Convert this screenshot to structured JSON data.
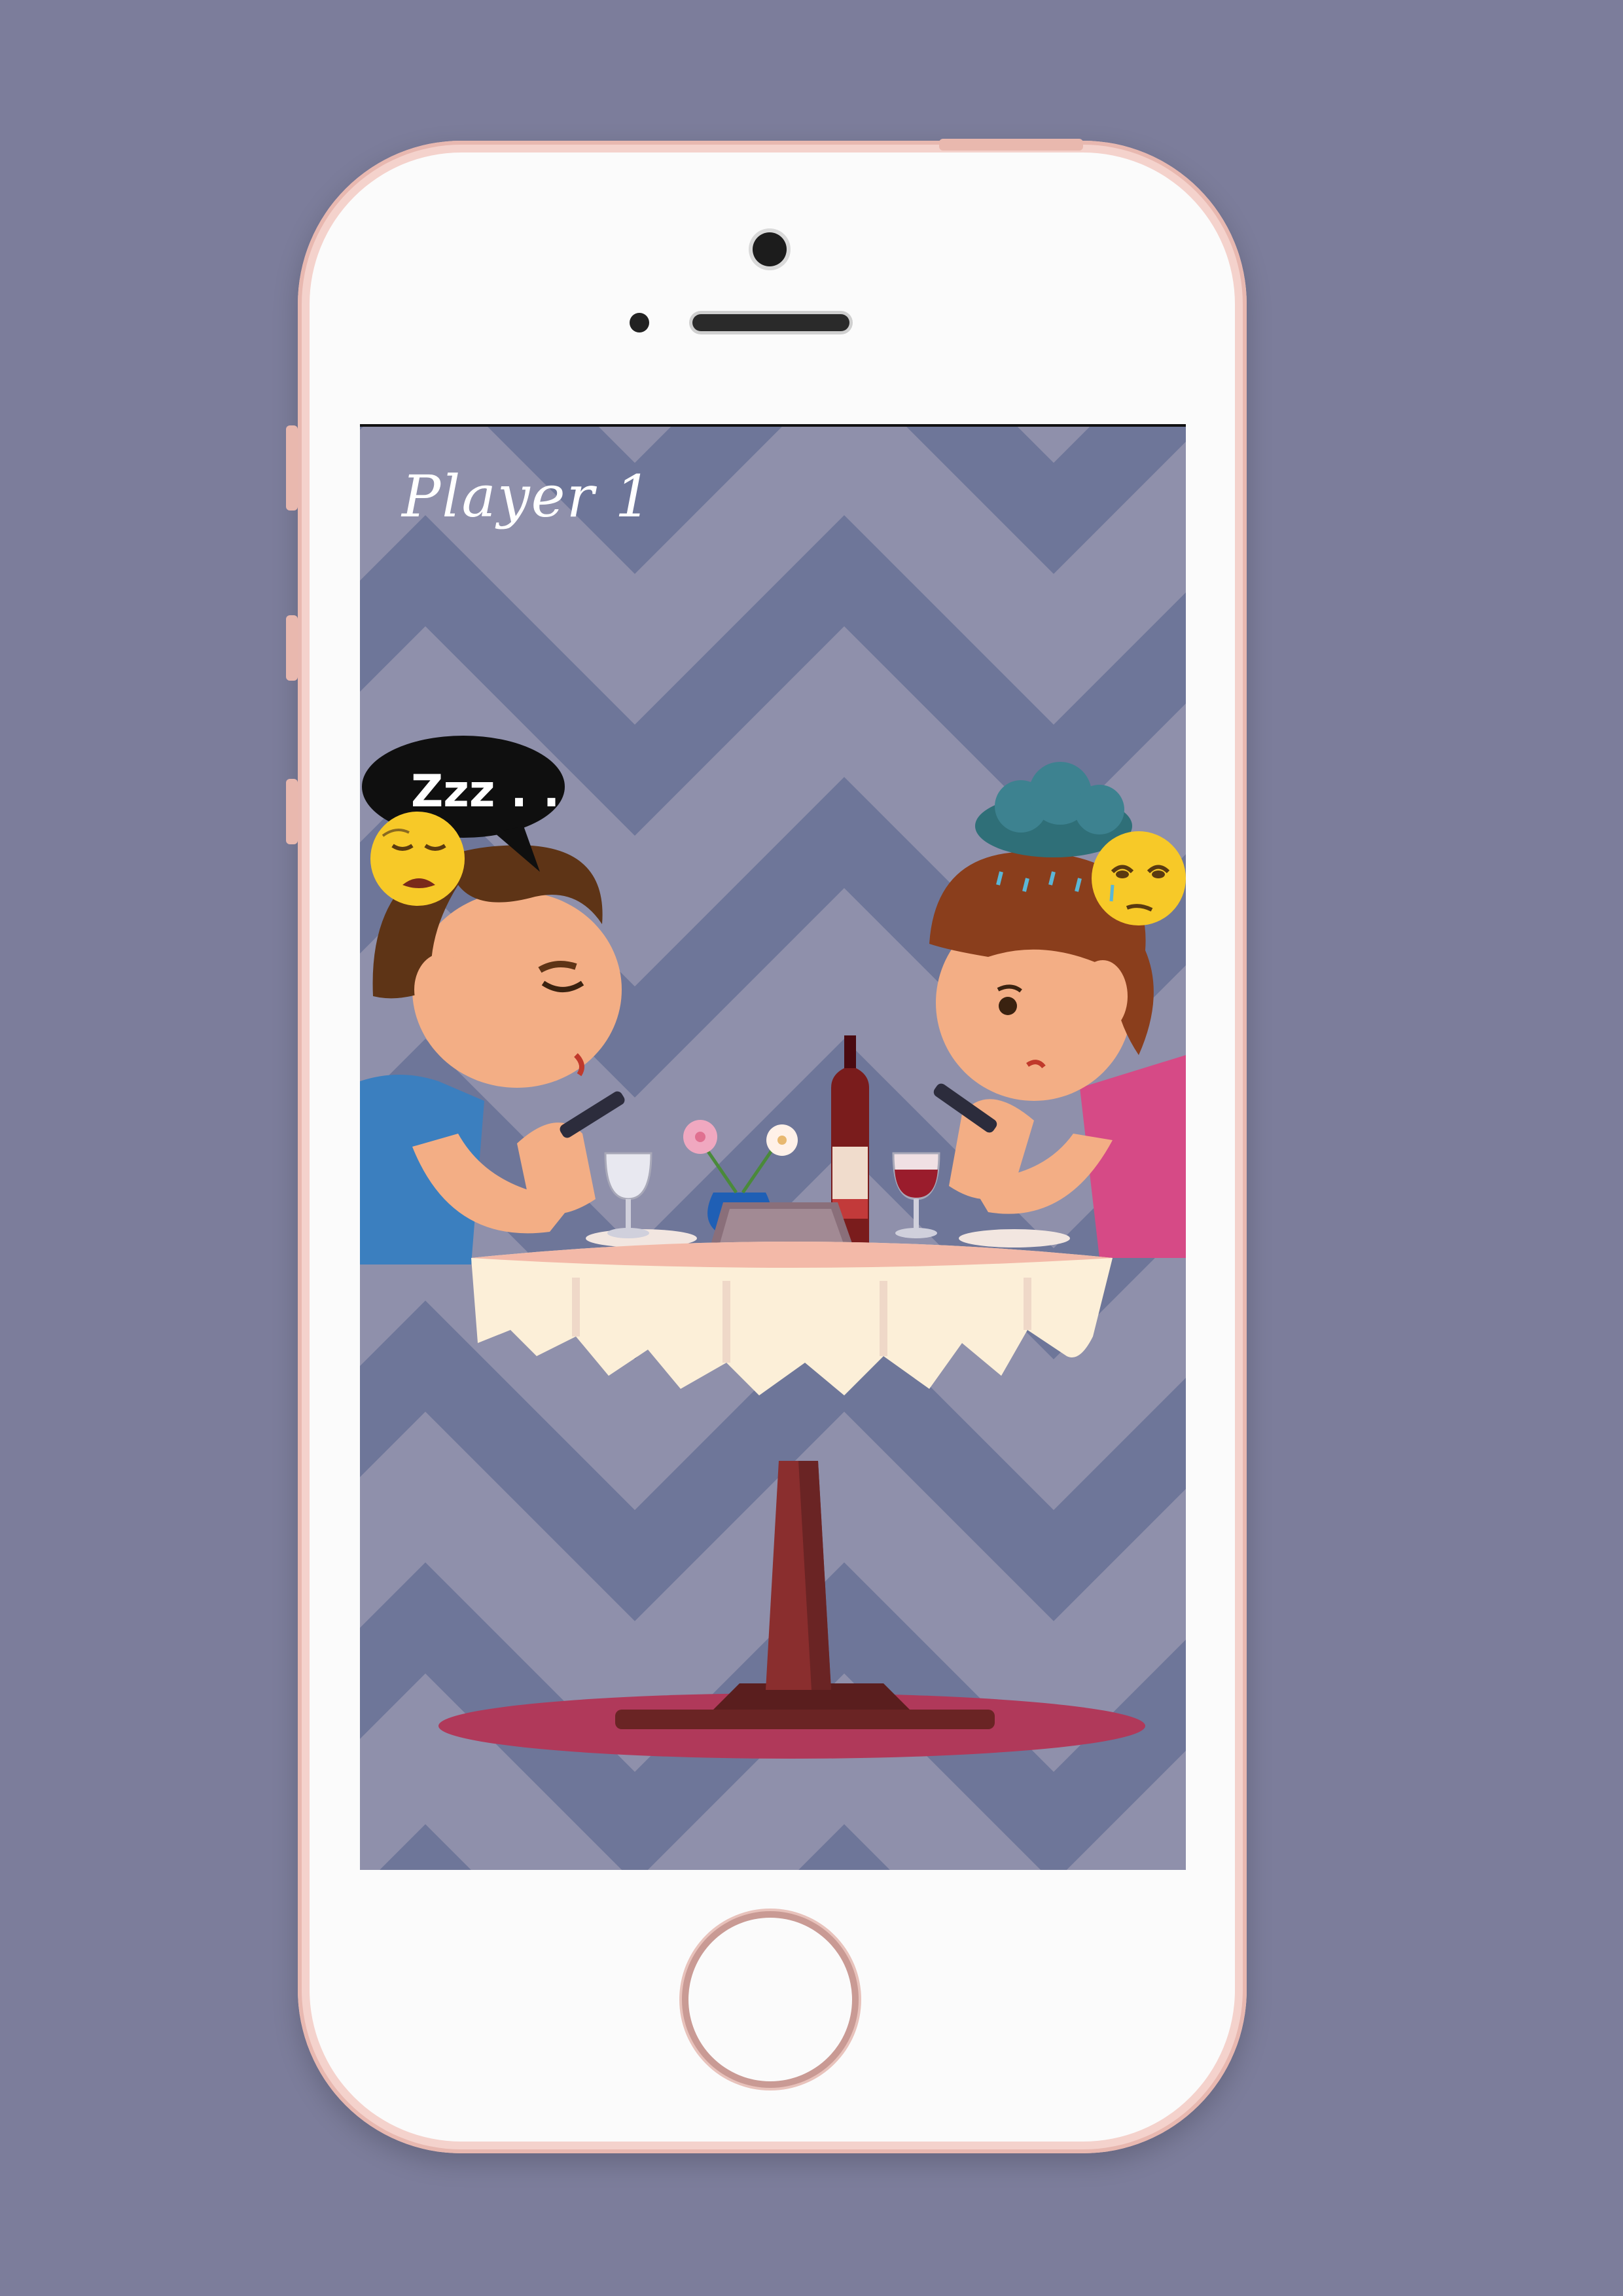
{
  "screen": {
    "player_label": "Player 1",
    "speech_bubble": "Zzz . ."
  },
  "colors": {
    "background": "#7c7d9b",
    "phone_body": "#f4d2cc",
    "wallpaper_dark": "#6d7599",
    "wallpaper_light": "#8f90ab",
    "tablecloth": "#fcefd8",
    "rug": "#b0395a"
  },
  "icons": {
    "sleepy_emoji": "sleepy-face-icon",
    "sad_emoji": "sad-face-icon",
    "rain_cloud": "rain-cloud-icon"
  }
}
